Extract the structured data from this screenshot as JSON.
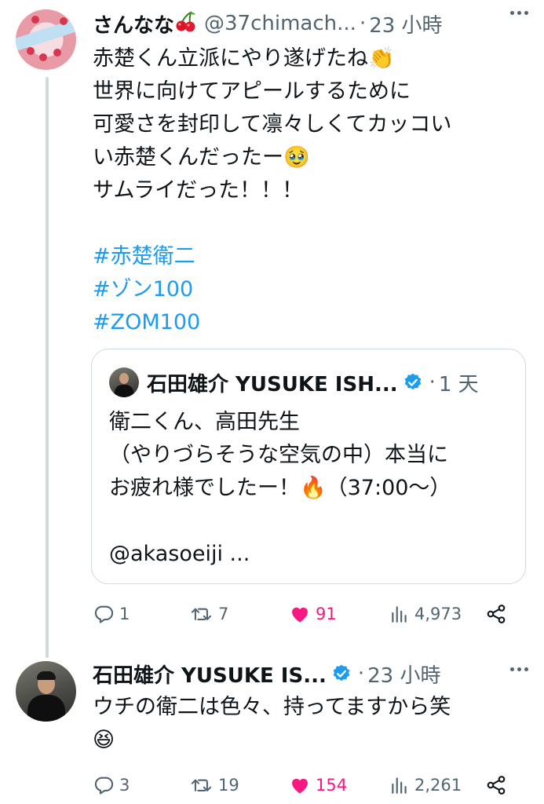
{
  "tweet": {
    "author_name": "さんなな",
    "author_emoji": "cherries",
    "handle": "@37chimach...",
    "separator": "·",
    "time": "23 小時",
    "lines": [
      "赤楚くん立派にやり遂げたね👏",
      "世界に向けてアピールするために",
      "可愛さを封印して凛々しくてカッコい",
      "い赤楚くんだったー🥹",
      "サムライだった！！！"
    ],
    "hashtags": [
      "#赤楚衛二",
      "#ゾン100",
      "#ZOM100"
    ],
    "quote": {
      "author_name": "石田雄介 YUSUKE ISH...",
      "verified": true,
      "separator": "·",
      "time": "1 天",
      "lines": [
        "衛二くん、高田先生",
        "（やりづらそうな空気の中）本当に",
        "お疲れ様でしたー！🔥（37:00〜）",
        "",
        "@akasoeiji ..."
      ]
    },
    "stats": {
      "replies": "1",
      "reposts": "7",
      "likes": "91",
      "views": "4,973"
    }
  },
  "reply": {
    "author_name": "石田雄介 YUSUKE IS...",
    "verified": true,
    "separator": "·",
    "time": "23 小時",
    "lines": [
      "ウチの衛二は色々、持ってますから笑",
      "😆"
    ],
    "stats": {
      "replies": "3",
      "reposts": "19",
      "likes": "154",
      "views": "2,261"
    }
  },
  "colors": {
    "accent": "#1d9bf0",
    "like": "#f91880",
    "muted": "#536471",
    "border": "#cfd9de"
  }
}
